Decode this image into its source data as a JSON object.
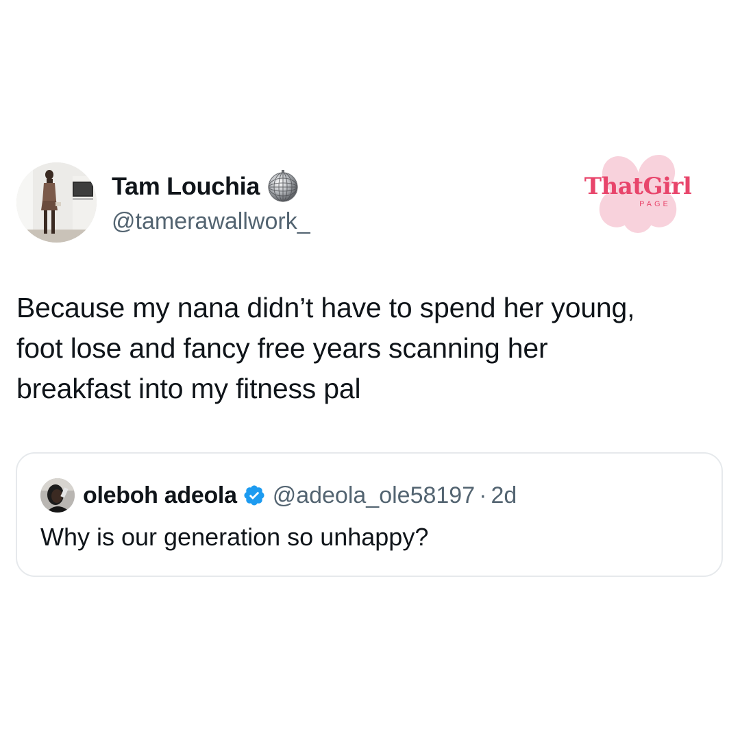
{
  "tweet": {
    "author": {
      "display_name": "Tam Louchia",
      "handle": "@tamerawallwork_",
      "badge_icon": "disco-ball-emoji"
    },
    "text": "Because my nana didn’t have to spend her young,\nfoot lose and fancy free years scanning her\nbreakfast into my fitness pal"
  },
  "quote": {
    "author": {
      "display_name": "oleboh adeola",
      "handle": "@adeola_ole58197",
      "verified": true
    },
    "separator": "·",
    "time": "2d",
    "text": "Why is our generation so unhappy?"
  },
  "logo": {
    "title": "ThatGirl",
    "subtitle": "PAGE"
  },
  "colors": {
    "text_primary": "#0f1419",
    "text_secondary": "#536471",
    "verified_blue": "#1d9bf0",
    "border": "#e6e9ec",
    "logo_pink": "#e8456b",
    "logo_flower": "#f8d2dc"
  }
}
